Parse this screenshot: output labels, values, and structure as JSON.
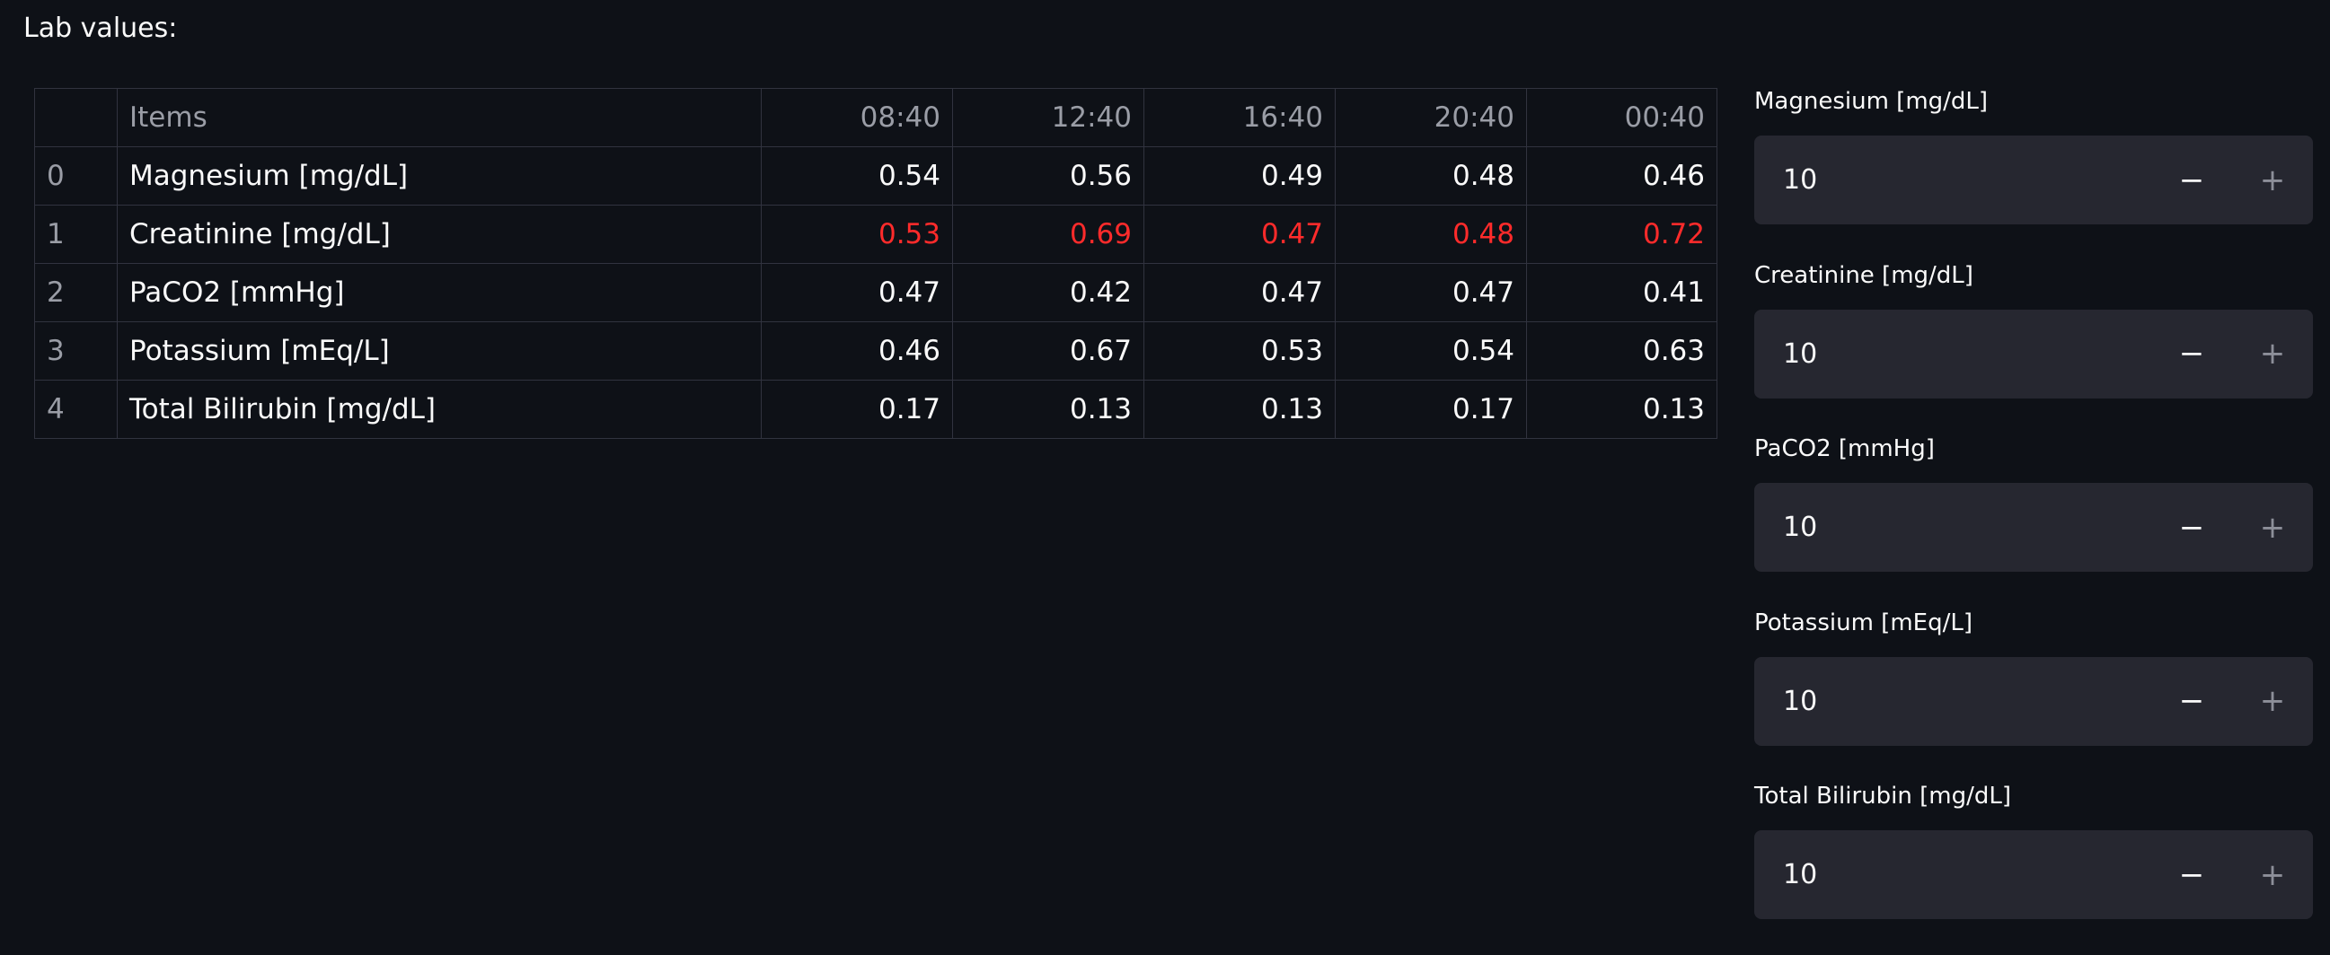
{
  "page": {
    "title": "Lab values:"
  },
  "table": {
    "columns": [
      "",
      "Items",
      "08:40",
      "12:40",
      "16:40",
      "20:40",
      "00:40"
    ],
    "rows": [
      {
        "index": "0",
        "item": "Magnesium [mg/dL]",
        "values": [
          "0.54",
          "0.56",
          "0.49",
          "0.48",
          "0.46"
        ],
        "flagged": false
      },
      {
        "index": "1",
        "item": "Creatinine [mg/dL]",
        "values": [
          "0.53",
          "0.69",
          "0.47",
          "0.48",
          "0.72"
        ],
        "flagged": true
      },
      {
        "index": "2",
        "item": "PaCO2 [mmHg]",
        "values": [
          "0.47",
          "0.42",
          "0.47",
          "0.47",
          "0.41"
        ],
        "flagged": false
      },
      {
        "index": "3",
        "item": "Potassium [mEq/L]",
        "values": [
          "0.46",
          "0.67",
          "0.53",
          "0.54",
          "0.63"
        ],
        "flagged": false
      },
      {
        "index": "4",
        "item": "Total Bilirubin [mg/dL]",
        "values": [
          "0.17",
          "0.13",
          "0.13",
          "0.17",
          "0.13"
        ],
        "flagged": false
      }
    ]
  },
  "inputs": [
    {
      "label": "Magnesium [mg/dL]",
      "value": "10",
      "minus": "−",
      "plus": "+"
    },
    {
      "label": "Creatinine [mg/dL]",
      "value": "10",
      "minus": "−",
      "plus": "+"
    },
    {
      "label": "PaCO2 [mmHg]",
      "value": "10",
      "minus": "−",
      "plus": "+"
    },
    {
      "label": "Potassium [mEq/L]",
      "value": "10",
      "minus": "−",
      "plus": "+"
    },
    {
      "label": "Total Bilirubin [mg/dL]",
      "value": "10",
      "minus": "−",
      "plus": "+"
    }
  ],
  "colors": {
    "background": "#0e1117",
    "text": "#fafafa",
    "muted_text": "#9a9da6",
    "flag_red": "#ff2b2b",
    "input_bg": "#262730",
    "grid_line": "#31333f"
  }
}
